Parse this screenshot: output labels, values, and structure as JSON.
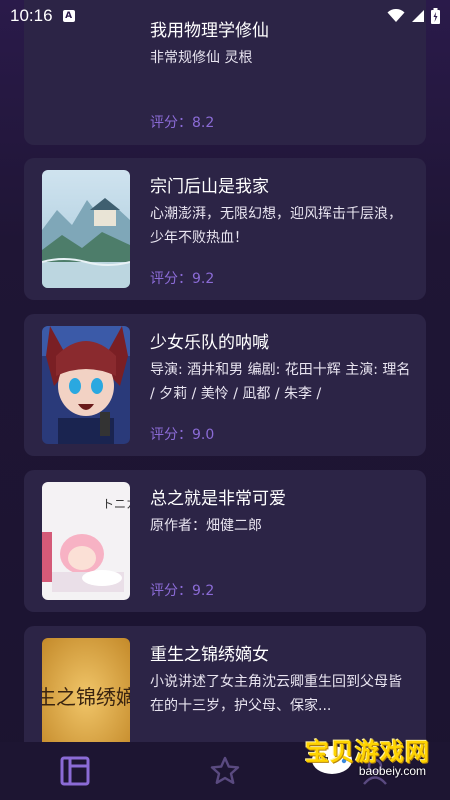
{
  "status_bar": {
    "time": "10:16",
    "notification_badge": "A"
  },
  "items": [
    {
      "title": "我用物理学修仙",
      "desc": "非常规修仙 灵根",
      "score": "评分：8.2"
    },
    {
      "title": "宗门后山是我家",
      "desc": "心潮澎湃，无限幻想，迎风挥击千层浪，少年不败热血！",
      "score": "评分：9.2"
    },
    {
      "title": "少女乐队的呐喊",
      "desc": "导演: 酒井和男 编剧: 花田十辉 主演: 理名 / 夕莉 / 美怜 / 凪都 / 朱李 /",
      "score": "评分：9.0"
    },
    {
      "title": "总之就是非常可爱",
      "desc": "原作者：畑健二郎",
      "score": "评分：9.2"
    },
    {
      "title": "重生之锦绣嫡女",
      "desc": "小说讲述了女主角沈云卿重生回到父母皆在的十三岁，护父母、保家...",
      "score": "",
      "cover_text": "生之锦绣嫡",
      "cover_small_text": "トニカ"
    }
  ],
  "nav": {
    "items": [
      "library-icon",
      "star-icon",
      "user-icon"
    ],
    "active_color": "#8b6bd6",
    "inactive_color": "#5a4a80"
  },
  "watermark": {
    "text": "宝贝游戏网",
    "url": "baobeiy.com"
  },
  "colors": {
    "card_bg": "#2c2446",
    "score": "#8b6bd6",
    "page_bg": "#1f1535"
  }
}
